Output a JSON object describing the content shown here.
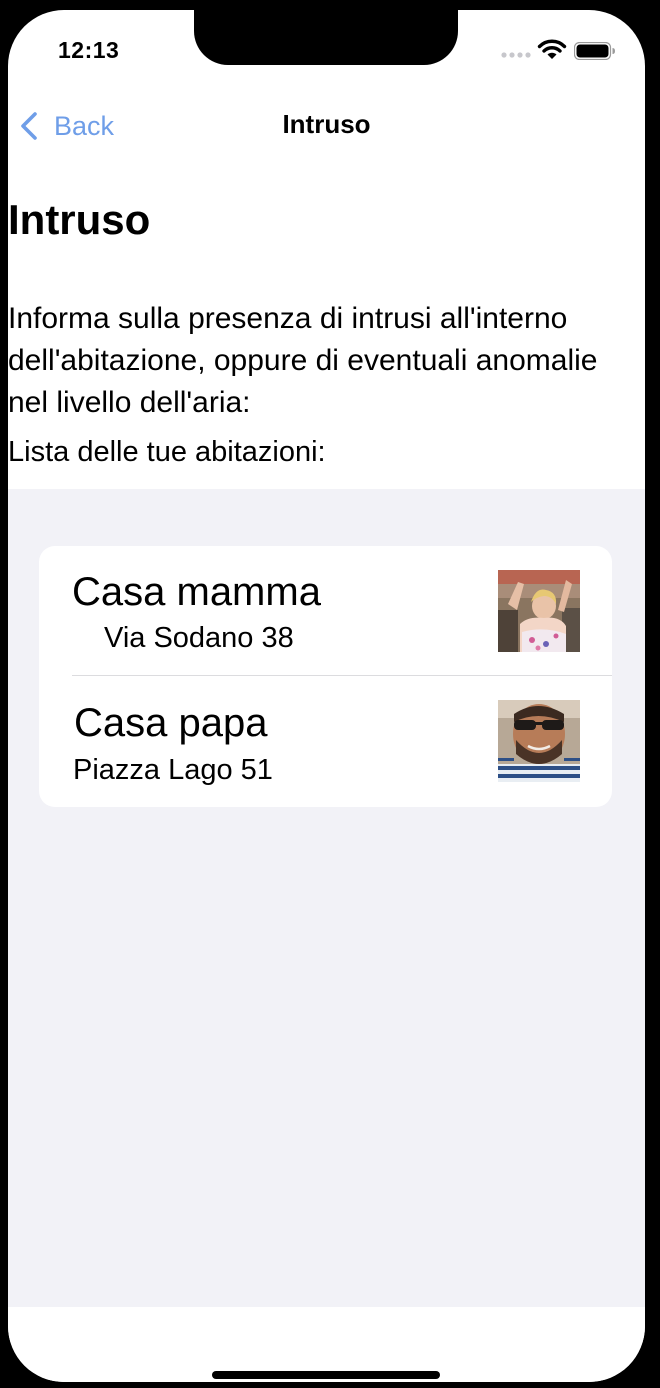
{
  "status_bar": {
    "time": "12:13",
    "icons": [
      "signal-dots-icon",
      "wifi-icon",
      "battery-icon"
    ]
  },
  "nav_bar": {
    "back_label": "Back",
    "back_icon": "chevron-left-icon",
    "title": "Intruso"
  },
  "page": {
    "title": "Intruso",
    "description": "Informa sulla presenza di intrusi all'interno dell'abitazione, oppure di eventuali anomalie nel livello dell'aria:",
    "list_caption": "Lista delle tue abitazioni:"
  },
  "houses": [
    {
      "name": "Casa mamma",
      "address": "Via Sodano 38",
      "photo": "woman-avatar"
    },
    {
      "name": "Casa papa",
      "address": "Piazza Lago 51",
      "photo": "man-avatar"
    }
  ],
  "colors": {
    "accent": "#4b8ef0",
    "list_background": "#f2f2f7",
    "card_background": "#ffffff"
  }
}
